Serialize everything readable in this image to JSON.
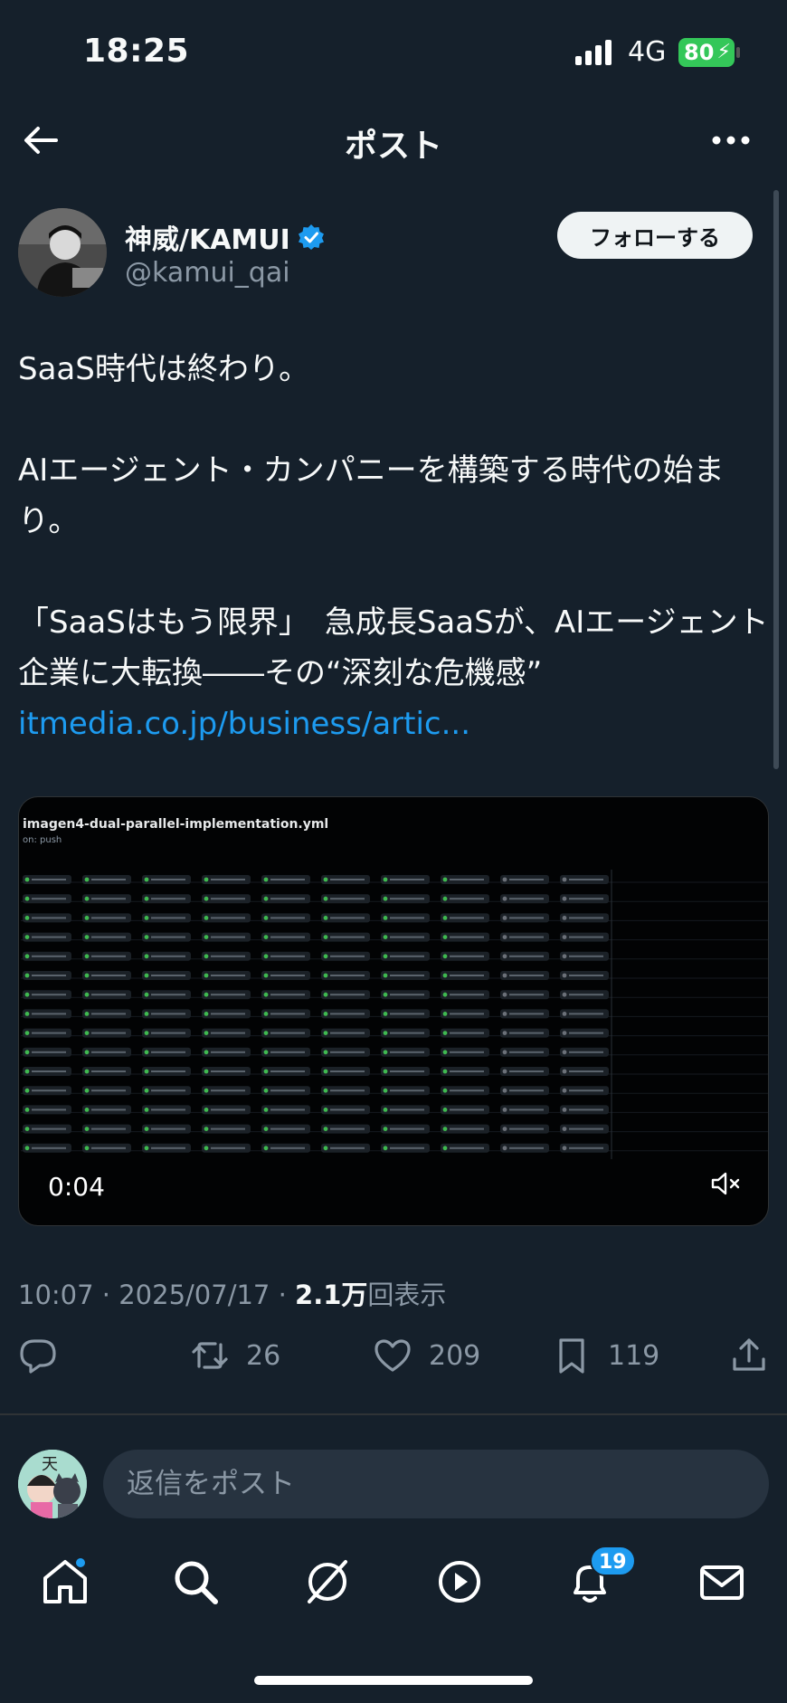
{
  "status": {
    "time": "18:25",
    "network": "4G",
    "battery": "80"
  },
  "nav": {
    "title": "ポスト"
  },
  "author": {
    "name": "神威/KAMUI",
    "handle": "@kamui_qai",
    "follow_label": "フォローする"
  },
  "tweet": {
    "text": "SaaS時代は終わり。\n\nAIエージェント・カンパニーを構築する時代の始まり。\n\n「SaaSはもう限界」　急成長SaaSが、AIエージェント企業に大転換――その“深刻な危機感”",
    "link": "itmedia.co.jp/business/artic..."
  },
  "media": {
    "title": "imagen4-dual-parallel-implementation.yml",
    "subtitle": "on: push",
    "time": "0:04"
  },
  "meta": {
    "timestamp": "10:07 · 2025/07/17 · ",
    "views_count": "2.1万",
    "views_label": "回表示"
  },
  "actions": {
    "retweets": "26",
    "likes": "209",
    "bookmarks": "119"
  },
  "reply": {
    "placeholder": "返信をポスト"
  },
  "tabs": {
    "notifications_badge": "19"
  },
  "colors": {
    "background": "#15202b",
    "accent": "#1d9bf0",
    "muted": "#8b98a5",
    "battery": "#34c759"
  }
}
